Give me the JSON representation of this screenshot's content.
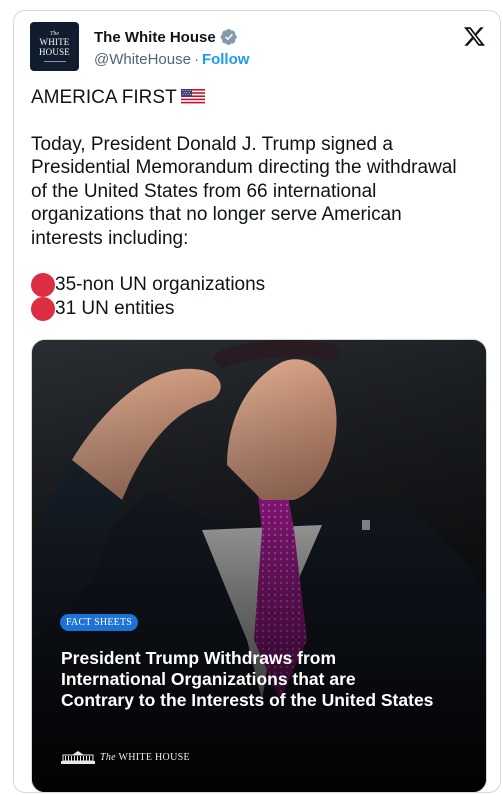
{
  "header": {
    "display_name": "The White House",
    "handle": "@WhiteHouse",
    "separator": "·",
    "follow_label": "Follow",
    "avatar_logo": {
      "the": "The",
      "line1": "WHITE",
      "line2": "HOUSE"
    },
    "verified_icon": "verified-badge-icon",
    "platform_icon": "x-logo-icon"
  },
  "tweet": {
    "headline": "AMERICA FIRST",
    "headline_emoji": "us-flag-icon",
    "paragraph": "Today, President Donald J. Trump signed a\nPresidential Memorandum directing the withdrawal\nof the United States from 66 international\norganizations that no longer serve American\ninterests including:",
    "bullets": [
      {
        "icon": "red-circle-icon",
        "text": "35-non UN organizations"
      },
      {
        "icon": "red-circle-icon",
        "text": "31 UN entities"
      }
    ]
  },
  "media": {
    "badge": "FACT SHEETS",
    "title": "President Trump Withdraws from\nInternational Organizations that are\nContrary to the Interests of the United States",
    "brand_the": "The",
    "brand_name": "WHITE HOUSE"
  },
  "colors": {
    "accent": "#1d9bf0",
    "text": "#0f1419",
    "secondary_text": "#536471",
    "bullet": "#dd2e44",
    "badge": "#1d72d8"
  }
}
